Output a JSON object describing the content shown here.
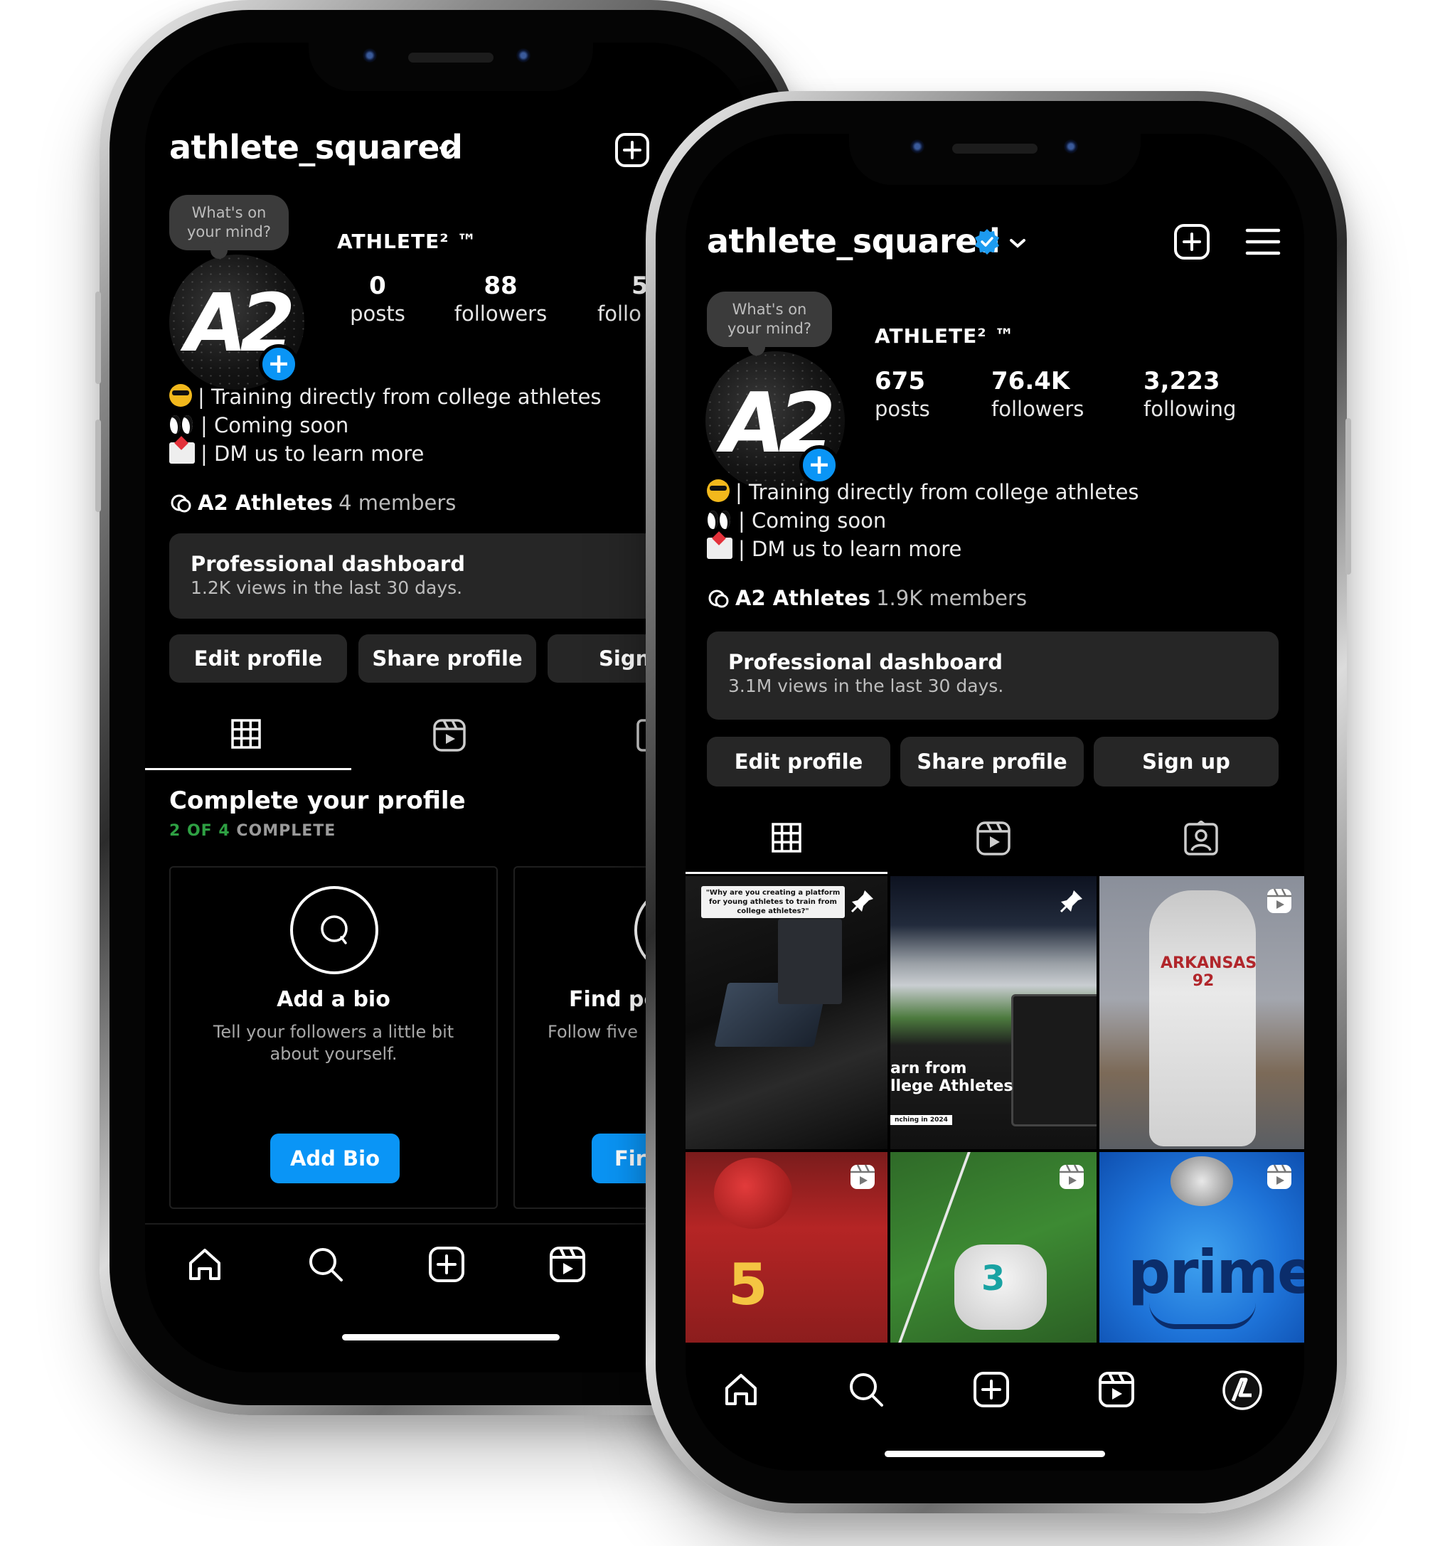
{
  "phones": [
    {
      "id": "back",
      "username": "athlete_squared",
      "bubble_text": "What's on your mind?",
      "display_name": "ATHLETE² ™",
      "stats": [
        {
          "value": "0",
          "label": "posts"
        },
        {
          "value": "88",
          "label": "followers"
        },
        {
          "value": "5",
          "label": "follo"
        }
      ],
      "bio": [
        "| Training directly from college athletes",
        "| Coming soon",
        "| DM us to learn more"
      ],
      "channel": {
        "name": "A2 Athletes",
        "members": "4 members"
      },
      "dashboard": {
        "title": "Professional dashboard",
        "subtitle": "1.2K views in the last 30 days."
      },
      "buttons": [
        "Edit profile",
        "Share profile",
        "Sign"
      ],
      "complete_profile": {
        "title": "Complete your profile",
        "progress_done": "2 OF 4",
        "progress_label": "COMPLETE",
        "cards": [
          {
            "title": "Add a bio",
            "desc": "Tell your followers a little bit about yourself.",
            "button": "Add Bio"
          },
          {
            "title": "Find pe",
            "desc": "Follow five",
            "button": "Fir"
          }
        ]
      }
    },
    {
      "id": "front",
      "username": "athlete_squared",
      "verified": true,
      "bubble_text": "What's on your mind?",
      "display_name": "ATHLETE² ™",
      "stats": [
        {
          "value": "675",
          "label": "posts"
        },
        {
          "value": "76.4K",
          "label": "followers"
        },
        {
          "value": "3,223",
          "label": "following"
        }
      ],
      "bio": [
        "| Training directly from college athletes",
        "| Coming soon",
        "| DM us to learn more"
      ],
      "channel": {
        "name": "A2 Athletes",
        "members": "1.9K members"
      },
      "dashboard": {
        "title": "Professional dashboard",
        "subtitle": "3.1M views in the last 30 days."
      },
      "buttons": [
        "Edit profile",
        "Share profile",
        "Sign up"
      ],
      "posts": [
        {
          "type": "pinned",
          "caption": "\"Why are you creating a platform for young athletes to train from college athletes?\""
        },
        {
          "type": "pinned",
          "overlay_line1": "arn from",
          "overlay_line2": "llege Athletes",
          "tag": "nching in 2024"
        },
        {
          "type": "reel",
          "jersey": "ARKANSAS 92"
        },
        {
          "type": "reel",
          "jersey": "5"
        },
        {
          "type": "reel",
          "jersey": "3"
        },
        {
          "type": "reel",
          "brand": "prime"
        }
      ]
    }
  ],
  "colors": {
    "accent": "#0a95f6",
    "progress": "#2ea043",
    "surface": "#262626",
    "background": "#000000"
  },
  "nav_icons": [
    "home-icon",
    "search-icon",
    "create-icon",
    "reels-icon",
    "profile-avatar-icon"
  ]
}
